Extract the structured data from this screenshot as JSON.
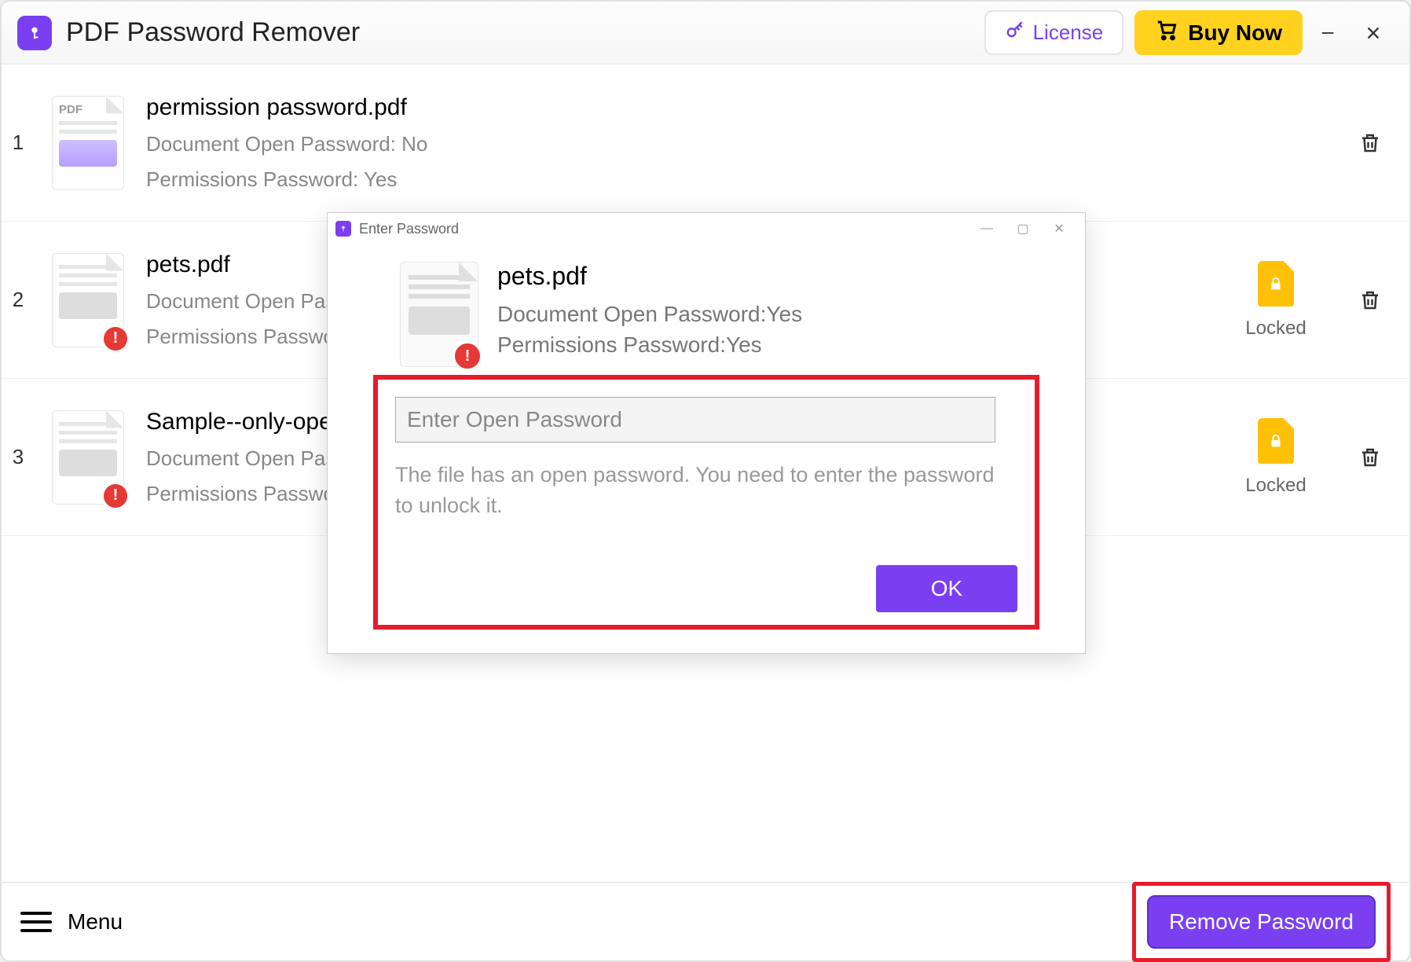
{
  "titlebar": {
    "app_title": "PDF Password Remover",
    "license_label": "License",
    "buy_label": "Buy Now"
  },
  "files": [
    {
      "name": "permission password.pdf",
      "open_pw": "Document Open Password: No",
      "perm_pw": "Permissions Password: Yes",
      "locked": false
    },
    {
      "name": "pets.pdf",
      "open_pw": "Document Open Password:Yes",
      "perm_pw": "Permissions Password:Yes",
      "locked": true,
      "locked_label": "Locked"
    },
    {
      "name": "Sample--only-open-pwd.pdf",
      "open_pw": "Document Open Password:Yes",
      "perm_pw": "Permissions Password:No",
      "locked": true,
      "locked_label": "Locked"
    }
  ],
  "bottom": {
    "menu_label": "Menu",
    "remove_label": "Remove Password"
  },
  "dialog": {
    "title": "Enter Password",
    "file_name": "pets.pdf",
    "open_pw": "Document Open Password:Yes",
    "perm_pw": "Permissions Password:Yes",
    "placeholder": "Enter Open Password",
    "hint": "The file has an open password. You need to enter the password to unlock it.",
    "ok_label": "OK"
  }
}
